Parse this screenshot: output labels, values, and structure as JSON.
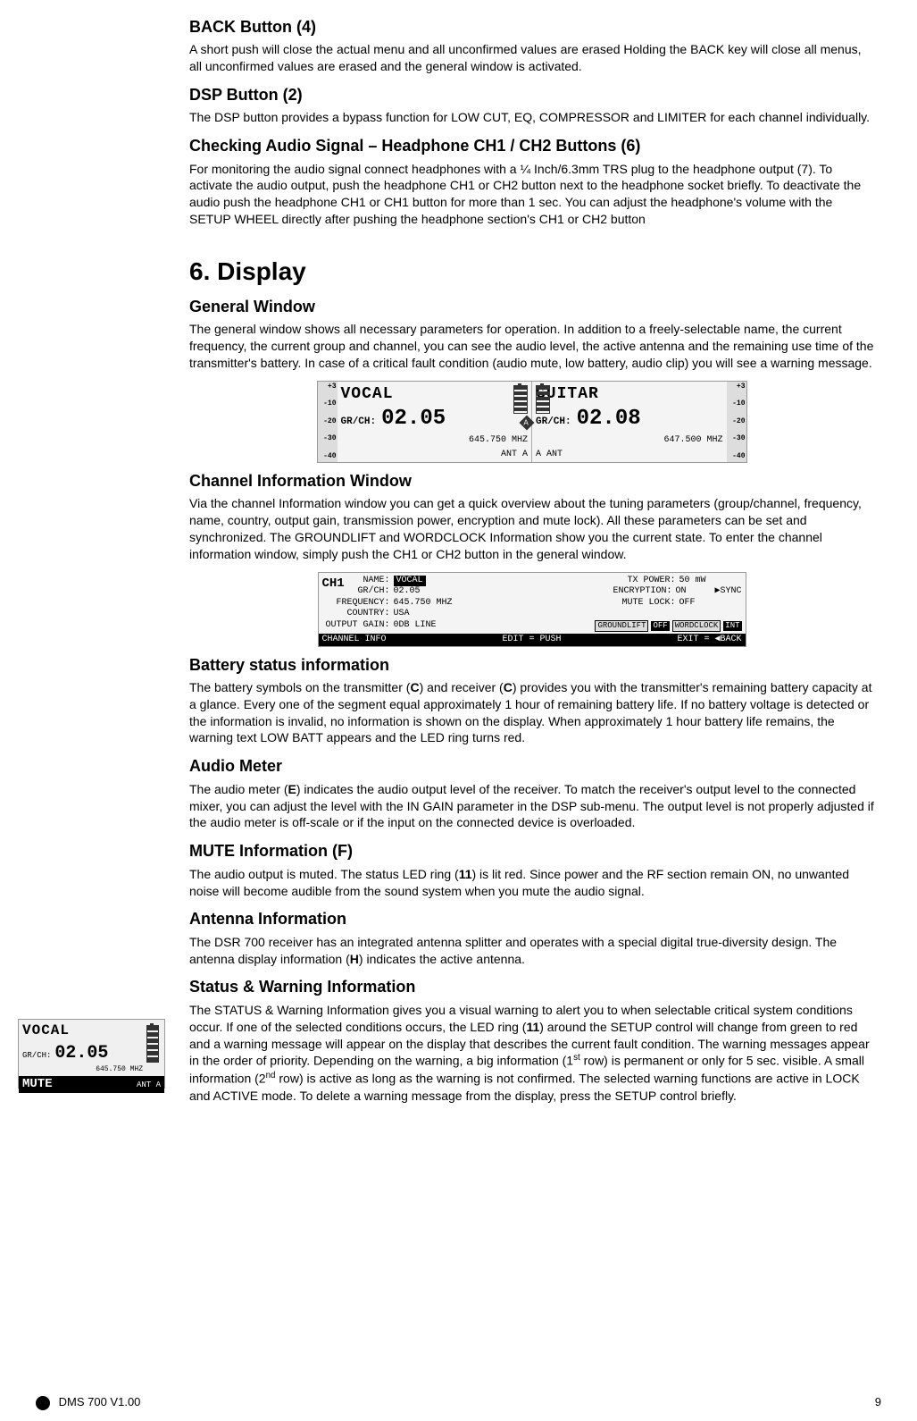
{
  "sections": {
    "back": {
      "title": "BACK Button (4)",
      "body": "A short push will close the actual menu and all unconfirmed values are erased  Holding the BACK key will close all menus, all unconfirmed values are erased and the general window is activated."
    },
    "dsp": {
      "title": "DSP Button (2)",
      "body": "The DSP button provides a bypass function for LOW CUT, EQ, COMPRESSOR and LIMITER for each channel individually."
    },
    "check": {
      "title": "Checking Audio Signal – Headphone CH1 / CH2 Buttons (6)",
      "body": "For monitoring the audio signal connect headphones with a ¼ Inch/6.3mm TRS plug to the headphone output (7). To activate the audio output, push the headphone CH1 or CH2 button next to the headphone socket briefly. To deactivate the audio push the headphone CH1 or CH1 button for more than 1 sec. You can adjust the headphone's volume with the SETUP WHEEL directly after pushing the headphone section's CH1 or CH2 button"
    },
    "chapter": "6. Display",
    "general": {
      "title": "General Window",
      "body": "The general window shows all necessary parameters for operation. In addition to a freely-selectable name, the current frequency, the current group and channel, you can see the audio level, the active antenna and the remaining use time of the transmitter's battery. In case of a critical fault condition (audio mute, low battery, audio clip) you will see a warning message."
    },
    "chinfo": {
      "title": "Channel Information Window",
      "body": "Via the channel Information window you can get a quick overview about the tuning parameters (group/channel, frequency, name, country, output gain, transmission power, encryption and mute lock). All these parameters can be set and synchronized. The GROUNDLIFT and WORDCLOCK Information show you the current state. To enter the channel information window, simply push the CH1 or CH2 button in the general window."
    },
    "battery": {
      "title": "Battery status information",
      "body_pre": "The battery symbols on the transmitter (",
      "body_mid1": ") and receiver (",
      "body_mid2": ") provides you with the transmitter's remaining battery capacity at a glance. Every one of the segment equal approximately 1 hour of remaining battery life. If no battery voltage is detected or the information is invalid, no information is shown on the display. When approximately 1 hour battery life remains,  the warning text LOW BATT appears and the LED ring turns red.",
      "ref1": "C",
      "ref2": "C"
    },
    "meter": {
      "title": "Audio Meter",
      "body_pre": "The audio meter (",
      "ref": "E",
      "body_post": ") indicates the audio output level of the receiver. To match the receiver's output level to the connected mixer, you can adjust the level with the IN GAIN parameter in the DSP sub-menu. The output level is not properly adjusted if the audio meter is off-scale or if the input on the connected device is overloaded."
    },
    "mute": {
      "title": "MUTE Information (F)",
      "body_pre": "The audio output is muted. The status LED ring (",
      "ref": "11",
      "body_post": ") is lit red. Since power and the RF section remain ON, no unwanted noise will become audible from the sound system when you mute the audio signal."
    },
    "antenna": {
      "title": "Antenna Information",
      "body_pre": "The DSR 700 receiver has an integrated antenna splitter and operates with a special digital true-diversity design. The antenna display information (",
      "ref": "H",
      "body_post": ") indicates the active antenna."
    },
    "status": {
      "title": "Status & Warning Information",
      "body_pre": "The STATUS & Warning Information gives you a visual warning to alert you to when selectable critical system conditions occur. If one of the selected conditions occurs, the LED ring (",
      "ref": "11",
      "body_mid": ") around the SETUP control will change from green to red and a warning message will appear on the display that describes the current fault condition. The warning messages appear in the order of priority. Depending on the warning, a big information (1",
      "sup1": "st",
      "body_mid2": " row) is permanent or only for 5 sec. visible. A small information (2",
      "sup2": "nd",
      "body_post": " row) is active as long as the warning is not confirmed. The selected warning functions are active in LOCK and ACTIVE mode. To delete a warning message from the display, press the SETUP control briefly."
    }
  },
  "display": {
    "scale": [
      "+3",
      "-10",
      "-20",
      "-30",
      "-40"
    ],
    "ch1": {
      "name": "VOCAL",
      "grch_label": "GR/CH:",
      "grch_value": "02.05",
      "freq": "645.750 MHZ",
      "ant": "ANT A"
    },
    "ch2": {
      "name": "GUITAR",
      "grch_label": "GR/CH:",
      "grch_value": "02.08",
      "freq": "647.500 MHZ",
      "ant": "A ANT"
    }
  },
  "chinfo_display": {
    "channel": "CH1",
    "rows": {
      "name_label": "NAME:",
      "name_value": "VOCAL",
      "grch_label": "GR/CH:",
      "grch_value": "02.05",
      "freq_label": "FREQUENCY:",
      "freq_value": "645.750 MHZ",
      "country_label": "COUNTRY:",
      "country_value": "USA",
      "gain_label": "OUTPUT GAIN:",
      "gain_value": "0DB LINE",
      "tx_label": "TX POWER:",
      "tx_value": "50 mW",
      "enc_label": "ENCRYPTION:",
      "enc_value": "ON",
      "mute_label": "MUTE LOCK:",
      "mute_value": "OFF",
      "sync": "▶SYNC",
      "groundlift": "GROUNDLIFT",
      "gl_val": "OFF",
      "wordclock": "WORDCLOCK",
      "wc_val": "INT"
    },
    "footer_left": "CHANNEL INFO",
    "footer_mid": "EDIT = PUSH",
    "footer_right": "EXIT = ◀BACK"
  },
  "mute_display": {
    "name": "VOCAL",
    "grch_label": "GR/CH:",
    "grch_value": "02.05",
    "freq": "645.750 MHZ",
    "mute": "MUTE",
    "ant": "ANT A"
  },
  "footer": {
    "left": "DMS 700 V1.00",
    "right": "9"
  }
}
